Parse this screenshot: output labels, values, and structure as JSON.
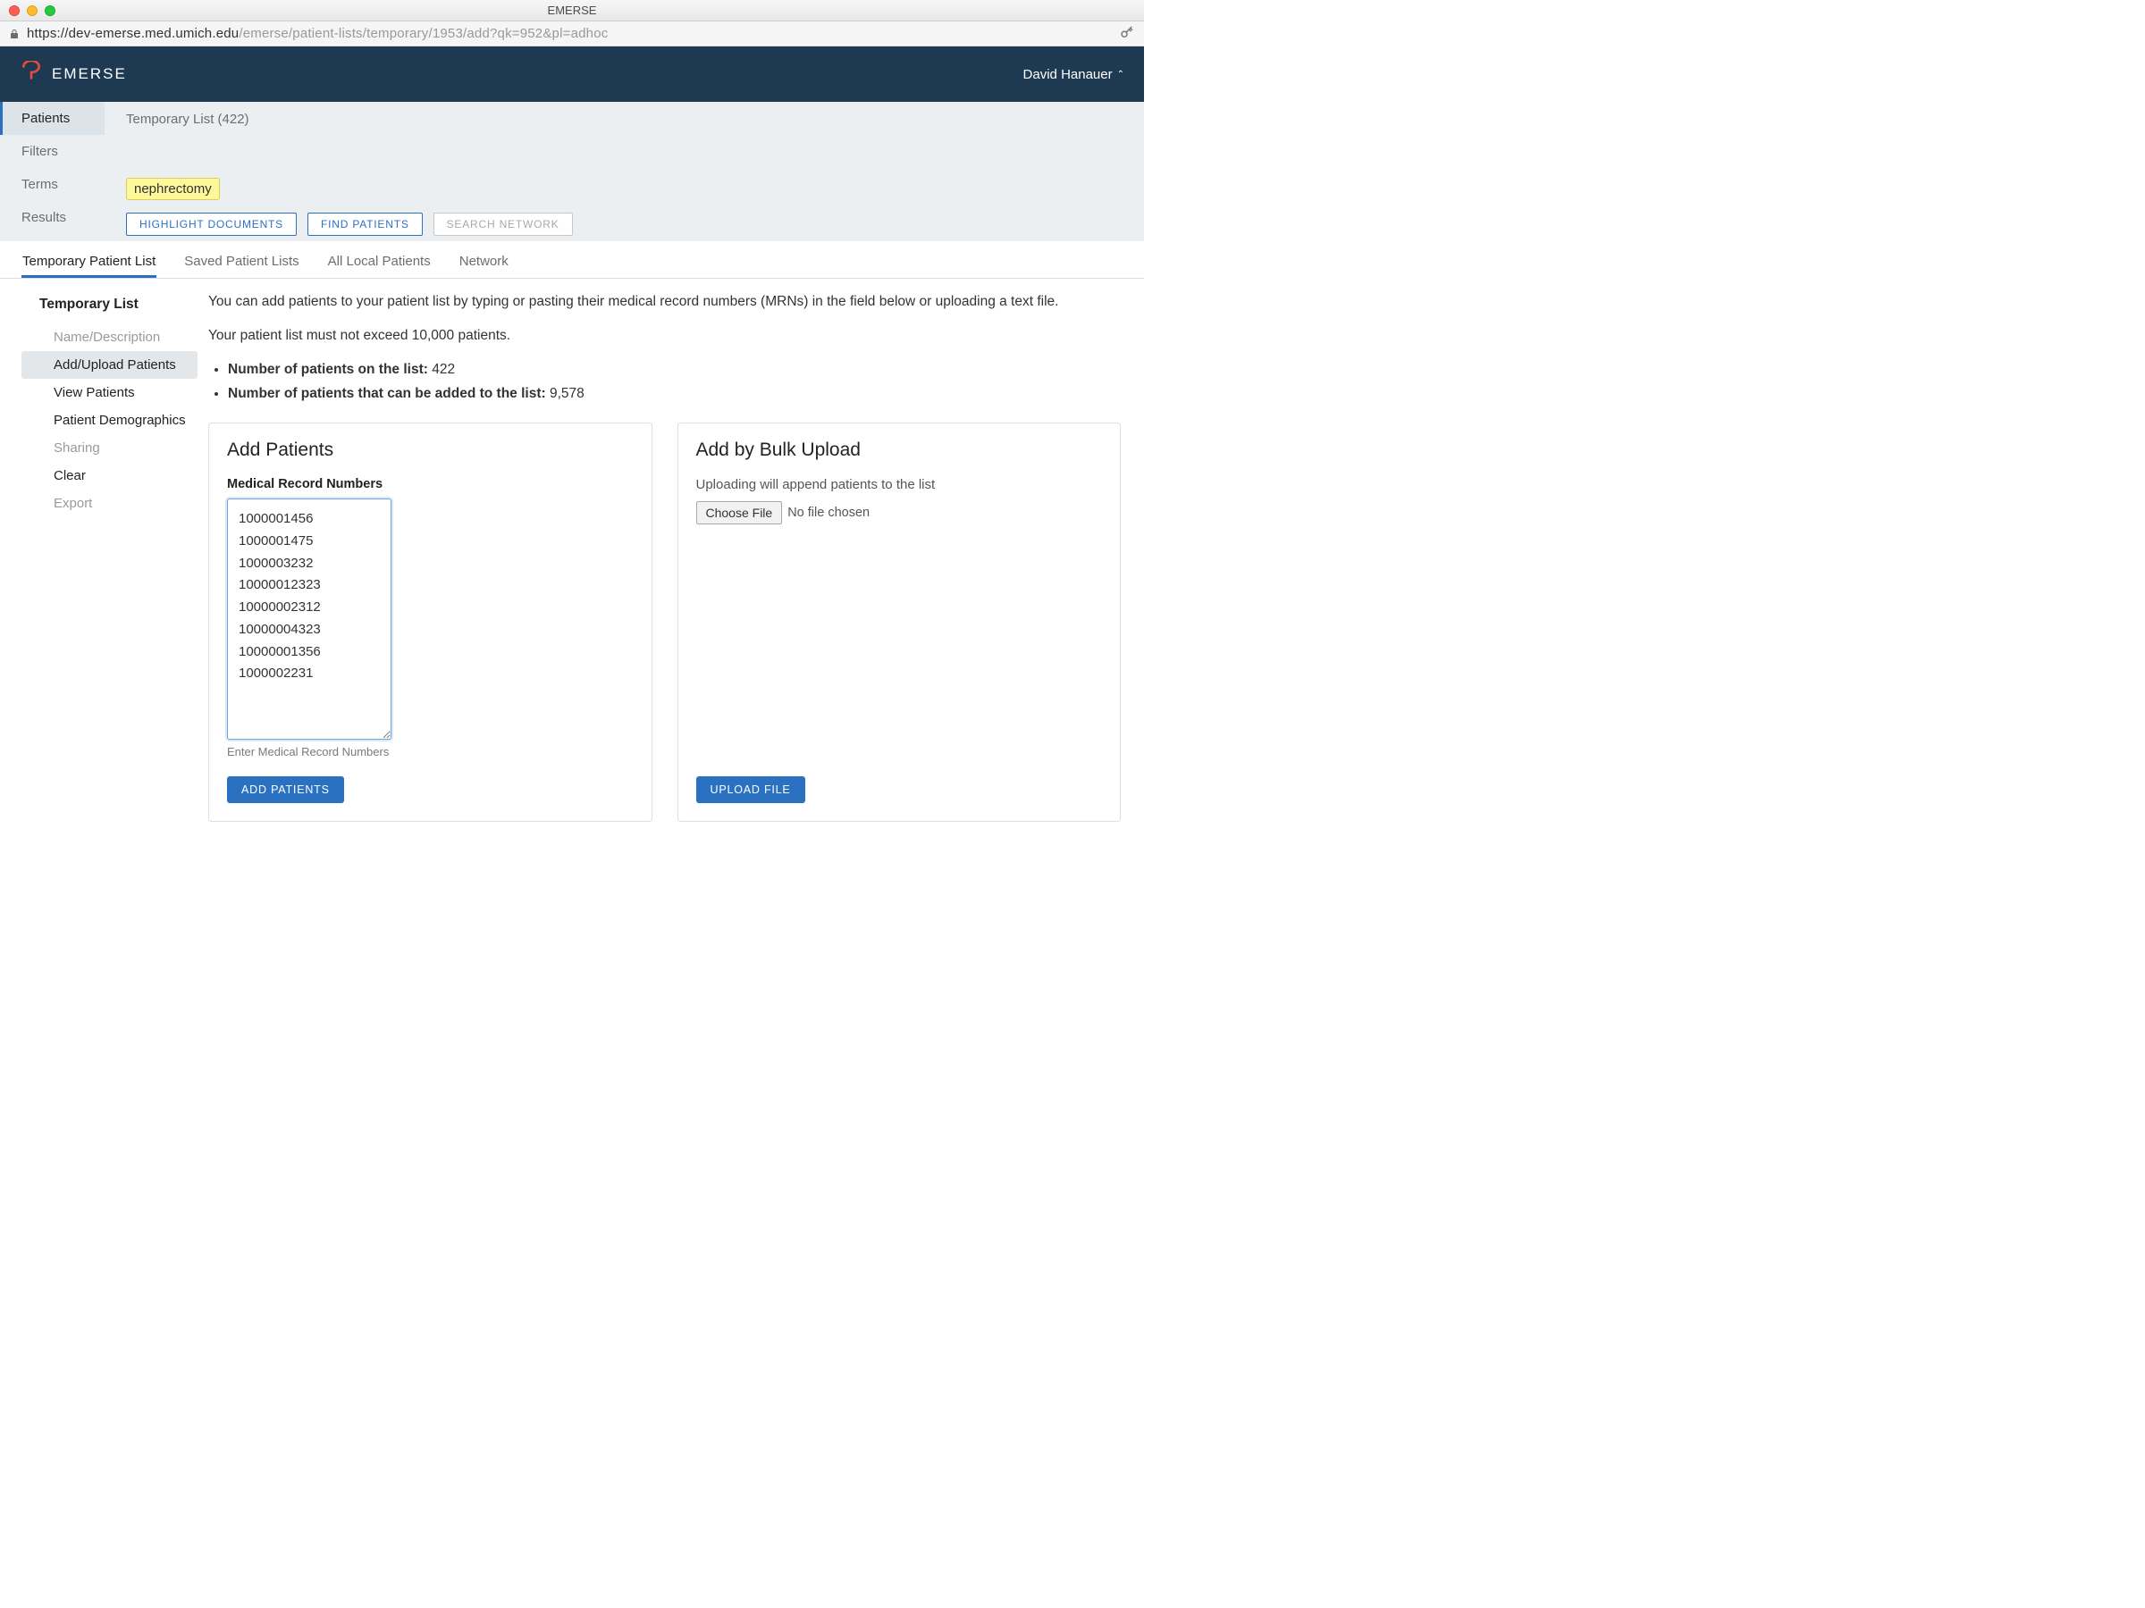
{
  "window": {
    "title": "EMERSE"
  },
  "url": {
    "host": "https://dev-emerse.med.umich.edu",
    "path": "/emerse/patient-lists/temporary/1953/add?qk=952&pl=adhoc"
  },
  "header": {
    "brand": "EMERSE",
    "user": "David Hanauer"
  },
  "context": {
    "left": [
      "Patients",
      "Filters",
      "Terms",
      "Results"
    ],
    "list_label": "Temporary List (422)",
    "term": "nephrectomy",
    "buttons": {
      "highlight": "HIGHLIGHT DOCUMENTS",
      "find": "FIND PATIENTS",
      "search": "SEARCH NETWORK"
    }
  },
  "tabs": [
    "Temporary Patient List",
    "Saved Patient Lists",
    "All Local Patients",
    "Network"
  ],
  "sidenav": {
    "group": "Temporary List",
    "items": [
      {
        "label": "Name/Description",
        "state": "muted"
      },
      {
        "label": "Add/Upload Patients",
        "state": "selected"
      },
      {
        "label": "View Patients",
        "state": "normal"
      },
      {
        "label": "Patient Demographics",
        "state": "normal"
      },
      {
        "label": "Sharing",
        "state": "muted"
      },
      {
        "label": "Clear",
        "state": "normal"
      },
      {
        "label": "Export",
        "state": "muted"
      }
    ]
  },
  "intro": {
    "p1": "You can add patients to your patient list by typing or pasting their medical record numbers (MRNs) in the field below or uploading a text file.",
    "p2": "Your patient list must not exceed 10,000 patients.",
    "count_label": "Number of patients on the list:",
    "count_value": "422",
    "remaining_label": "Number of patients that can be added to the list:",
    "remaining_value": "9,578"
  },
  "add_panel": {
    "title": "Add Patients",
    "field_label": "Medical Record Numbers",
    "value": "1000001456\n1000001475\n1000003232\n10000012323\n10000002312\n10000004323\n10000001356\n1000002231",
    "helper": "Enter Medical Record Numbers",
    "button": "ADD PATIENTS"
  },
  "upload_panel": {
    "title": "Add by Bulk Upload",
    "hint": "Uploading will append patients to the list",
    "choose": "Choose File",
    "status": "No file chosen",
    "button": "UPLOAD FILE"
  }
}
